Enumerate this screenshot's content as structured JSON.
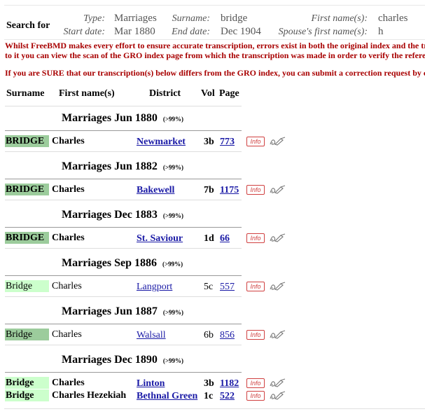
{
  "search": {
    "label": "Search for",
    "criteria": [
      {
        "label": "Type:",
        "value": "Marriages"
      },
      {
        "label": "Surname:",
        "value": "bridge"
      },
      {
        "label": "First name(s):",
        "value": "charles"
      },
      {
        "label": "Start date:",
        "value": "Mar 1880"
      },
      {
        "label": "End date:",
        "value": "Dec 1904"
      },
      {
        "label": "Spouse's first name(s):",
        "value": "h"
      }
    ]
  },
  "warnings": [
    "Whilst FreeBMD makes every effort to ensure accurate transcription, errors exist in both the original index and the tran",
    "to it you can view the scan of the GRO index page from which the transcription was made in order to verify the reference",
    "If you are SURE that our transcription(s) below differs from the GRO index, you can submit a correction request by clic"
  ],
  "columns": [
    "Surname",
    "First name(s)",
    "District",
    "Vol",
    "Page"
  ],
  "groups": [
    {
      "title": "Marriages Jun 1880",
      "pct": "(>99%)"
    },
    {
      "title": "Marriages Jun 1882",
      "pct": "(>99%)"
    },
    {
      "title": "Marriages Dec 1883",
      "pct": "(>99%)"
    },
    {
      "title": "Marriages Sep 1886",
      "pct": "(>99%)"
    },
    {
      "title": "Marriages Jun 1887",
      "pct": "(>99%)"
    },
    {
      "title": "Marriages Dec 1890",
      "pct": "(>99%)"
    }
  ],
  "records": [
    {
      "surname": "BRIDGE",
      "first": "Charles",
      "district": "Newmarket",
      "vol": "3b",
      "page": "773"
    },
    {
      "surname": "BRIDGE",
      "first": "Charles",
      "district": "Bakewell",
      "vol": "7b",
      "page": "1175"
    },
    {
      "surname": "BRIDGE",
      "first": "Charles",
      "district": "St. Saviour",
      "vol": "1d",
      "page": "66"
    },
    {
      "surname": "Bridge",
      "first": "Charles",
      "district": "Langport",
      "vol": "5c",
      "page": "557"
    },
    {
      "surname": "Bridge",
      "first": "Charles",
      "district": "Walsall",
      "vol": "6b",
      "page": "856"
    },
    {
      "surname": "Bridge",
      "first": "Charles",
      "district": "Linton",
      "vol": "3b",
      "page": "1182"
    },
    {
      "surname": "Bridge",
      "first": "Charles Hezekiah",
      "district": "Bethnal Green",
      "vol": "1c",
      "page": "522"
    }
  ],
  "info_label": "Info",
  "colors": {
    "warning": "#a80000",
    "link": "#1a1aa6",
    "surname_dark": "#9ccc9c",
    "surname_light": "#ccffcc",
    "info": "#d04040"
  }
}
